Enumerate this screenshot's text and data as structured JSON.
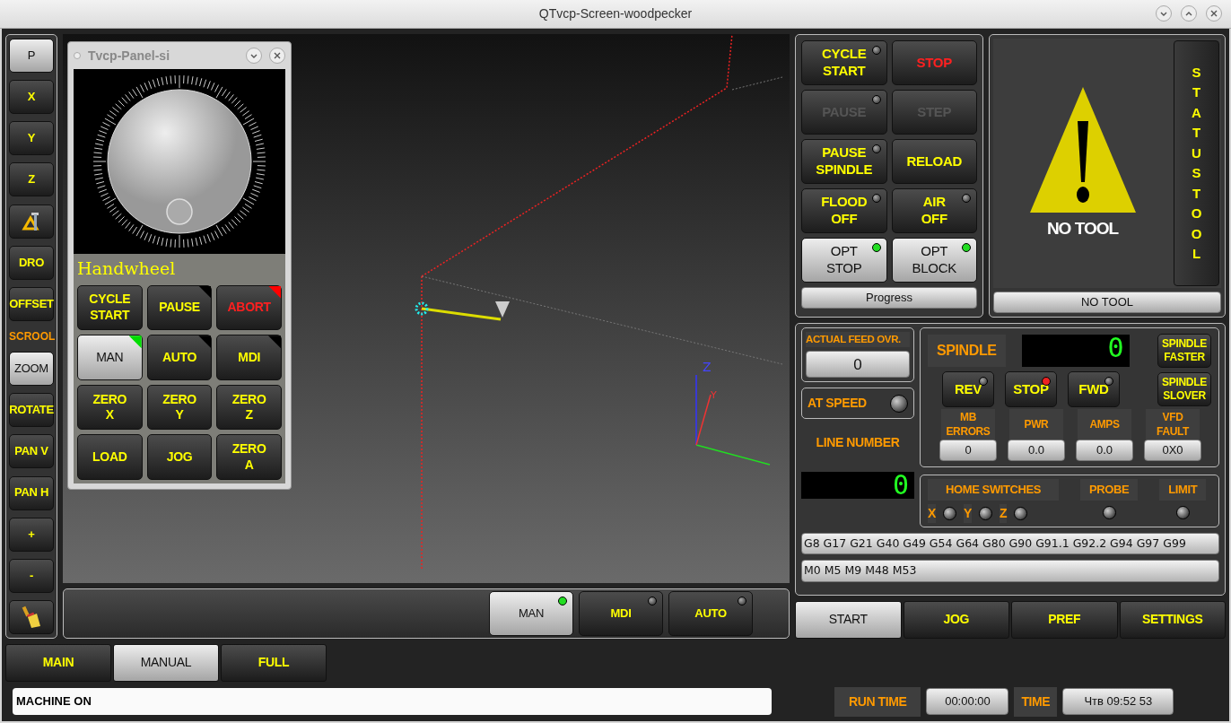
{
  "window": {
    "title": "QTvcp-Screen-woodpecker"
  },
  "sidebar": {
    "items": [
      {
        "kind": "button",
        "label": "P",
        "selected": true
      },
      {
        "kind": "button",
        "label": "X",
        "selected": false
      },
      {
        "kind": "button",
        "label": "Y",
        "selected": false
      },
      {
        "kind": "button",
        "label": "Z",
        "selected": false
      },
      {
        "kind": "tool",
        "selected": false
      },
      {
        "kind": "button",
        "label": "DRO",
        "selected": false
      },
      {
        "kind": "button",
        "label": "OFFSET",
        "selected": false
      },
      {
        "kind": "label",
        "label": "SCROOL"
      },
      {
        "kind": "button",
        "label": "ZOOM",
        "selected": true
      },
      {
        "kind": "button",
        "label": "ROTATE",
        "selected": false
      },
      {
        "kind": "button",
        "label": "PAN V",
        "selected": false
      },
      {
        "kind": "button",
        "label": "PAN H",
        "selected": false
      },
      {
        "kind": "button",
        "label": "+",
        "selected": false
      },
      {
        "kind": "button",
        "label": "-",
        "selected": false
      },
      {
        "kind": "broom",
        "selected": false
      }
    ]
  },
  "viewport": {
    "axis_labels": [
      "Z",
      "Y"
    ]
  },
  "panel": {
    "title": "Tvcp-Panel-si",
    "section": "Handwheel",
    "buttons": [
      {
        "lines": [
          "CYCLE",
          "START"
        ],
        "selected": false,
        "danger": false
      },
      {
        "lines": [
          "PAUSE"
        ],
        "selected": false,
        "danger": false,
        "color": "#000000"
      },
      {
        "lines": [
          "ABORT"
        ],
        "selected": false,
        "danger": true,
        "color": "#ff0000"
      },
      {
        "lines": [
          "MAN"
        ],
        "selected": true,
        "danger": false,
        "color": "#00dd00"
      },
      {
        "lines": [
          "AUTO"
        ],
        "selected": false,
        "danger": false,
        "color": "#000000"
      },
      {
        "lines": [
          "MDI"
        ],
        "selected": false,
        "danger": false,
        "color": "#000000"
      },
      {
        "lines": [
          "ZERO",
          "X"
        ],
        "selected": false,
        "danger": false
      },
      {
        "lines": [
          "ZERO",
          "Y"
        ],
        "selected": false,
        "danger": false
      },
      {
        "lines": [
          "ZERO",
          "Z"
        ],
        "selected": false,
        "danger": false
      },
      {
        "lines": [
          "LOAD"
        ],
        "selected": false,
        "danger": false
      },
      {
        "lines": [
          "JOG"
        ],
        "selected": false,
        "danger": false
      },
      {
        "lines": [
          "ZERO",
          "A"
        ],
        "selected": false,
        "danger": false
      }
    ]
  },
  "mode_buttons": [
    {
      "label": "MAN",
      "selected": true,
      "lit": true,
      "color": "#22dd22"
    },
    {
      "label": "MDI",
      "selected": false,
      "lit": false
    },
    {
      "label": "AUTO",
      "selected": false,
      "lit": false
    }
  ],
  "control": {
    "buttons": [
      {
        "lines": [
          "CYCLE",
          "START"
        ],
        "lit": false,
        "disabled": false,
        "danger": false,
        "selected": false
      },
      {
        "lines": [
          "STOP"
        ],
        "disabled": false,
        "danger": true,
        "selected": false
      },
      {
        "lines": [
          "PAUSE"
        ],
        "lit": false,
        "disabled": true,
        "danger": false,
        "selected": false
      },
      {
        "lines": [
          "STEP"
        ],
        "disabled": true,
        "danger": false,
        "selected": false
      },
      {
        "lines": [
          "PAUSE",
          "SPINDLE"
        ],
        "lit": false,
        "disabled": false,
        "danger": false,
        "selected": false
      },
      {
        "lines": [
          "RELOAD"
        ],
        "disabled": false,
        "danger": false,
        "selected": false
      },
      {
        "lines": [
          "FLOOD",
          "OFF"
        ],
        "lit": false,
        "disabled": false,
        "danger": false,
        "selected": false
      },
      {
        "lines": [
          "AIR",
          "OFF"
        ],
        "lit": false,
        "disabled": false,
        "danger": false,
        "selected": false
      },
      {
        "lines": [
          "OPT",
          "STOP"
        ],
        "lit": true,
        "color": "#22dd22",
        "disabled": false,
        "danger": false,
        "selected": true
      },
      {
        "lines": [
          "OPT",
          "BLOCK"
        ],
        "lit": true,
        "color": "#22dd22",
        "disabled": false,
        "danger": false,
        "selected": true
      }
    ],
    "progress": {
      "label": "Progress",
      "level": 0
    }
  },
  "tool": {
    "status": "NO TOOL",
    "side_label": "STATUS TOOL",
    "footer": "NO TOOL"
  },
  "feed": {
    "label": "ACTUAL FEED OVR.",
    "value": "0"
  },
  "at_speed": {
    "label": "AT SPEED",
    "on": false
  },
  "line_number": {
    "label": "LINE NUMBER",
    "value": "0"
  },
  "spindle": {
    "label": "SPINDLE",
    "speed": "0",
    "buttons": [
      {
        "label": "REV",
        "lit": false
      },
      {
        "label": "STOP",
        "lit": true,
        "color": "#ee2222"
      },
      {
        "label": "FWD",
        "lit": false
      }
    ],
    "faster": [
      "SPINDLE",
      "FASTER"
    ],
    "slower": [
      "SPINDLE",
      "SLOVER"
    ],
    "readouts": [
      {
        "lines": [
          "MB",
          "ERRORS"
        ],
        "value": "0"
      },
      {
        "lines": [
          "PWR"
        ],
        "value": "0.0"
      },
      {
        "lines": [
          "AMPS"
        ],
        "value": "0.0"
      },
      {
        "lines": [
          "VFD",
          "FAULT"
        ],
        "value": "0X0"
      }
    ]
  },
  "switches": {
    "home_label": "HOME SWITCHES",
    "axes": [
      {
        "label": "X",
        "on": false
      },
      {
        "label": "Y",
        "on": false
      },
      {
        "label": "Z",
        "on": false
      }
    ],
    "probe": {
      "label": "PROBE",
      "on": false
    },
    "limit": {
      "label": "LIMIT",
      "on": false
    }
  },
  "gcodes": "G8 G17 G21 G40 G49 G54 G64 G80 G90 G91.1 G92.2 G94 G97 G99",
  "mcodes": "M0 M5 M9 M48 M53",
  "tabs": [
    {
      "label": "START",
      "selected": true
    },
    {
      "label": "JOG",
      "selected": false
    },
    {
      "label": "PREF",
      "selected": false
    },
    {
      "label": "SETTINGS",
      "selected": false
    }
  ],
  "bottom_tabs": [
    {
      "label": "MAIN",
      "selected": false
    },
    {
      "label": "MANUAL",
      "selected": true
    },
    {
      "label": "FULL",
      "selected": false
    }
  ],
  "status": {
    "message": "MACHINE ON",
    "run_time_label": "RUN TIME",
    "run_time": "00:00:00",
    "time_label": "TIME",
    "time": "Чтв 09:52 53"
  }
}
